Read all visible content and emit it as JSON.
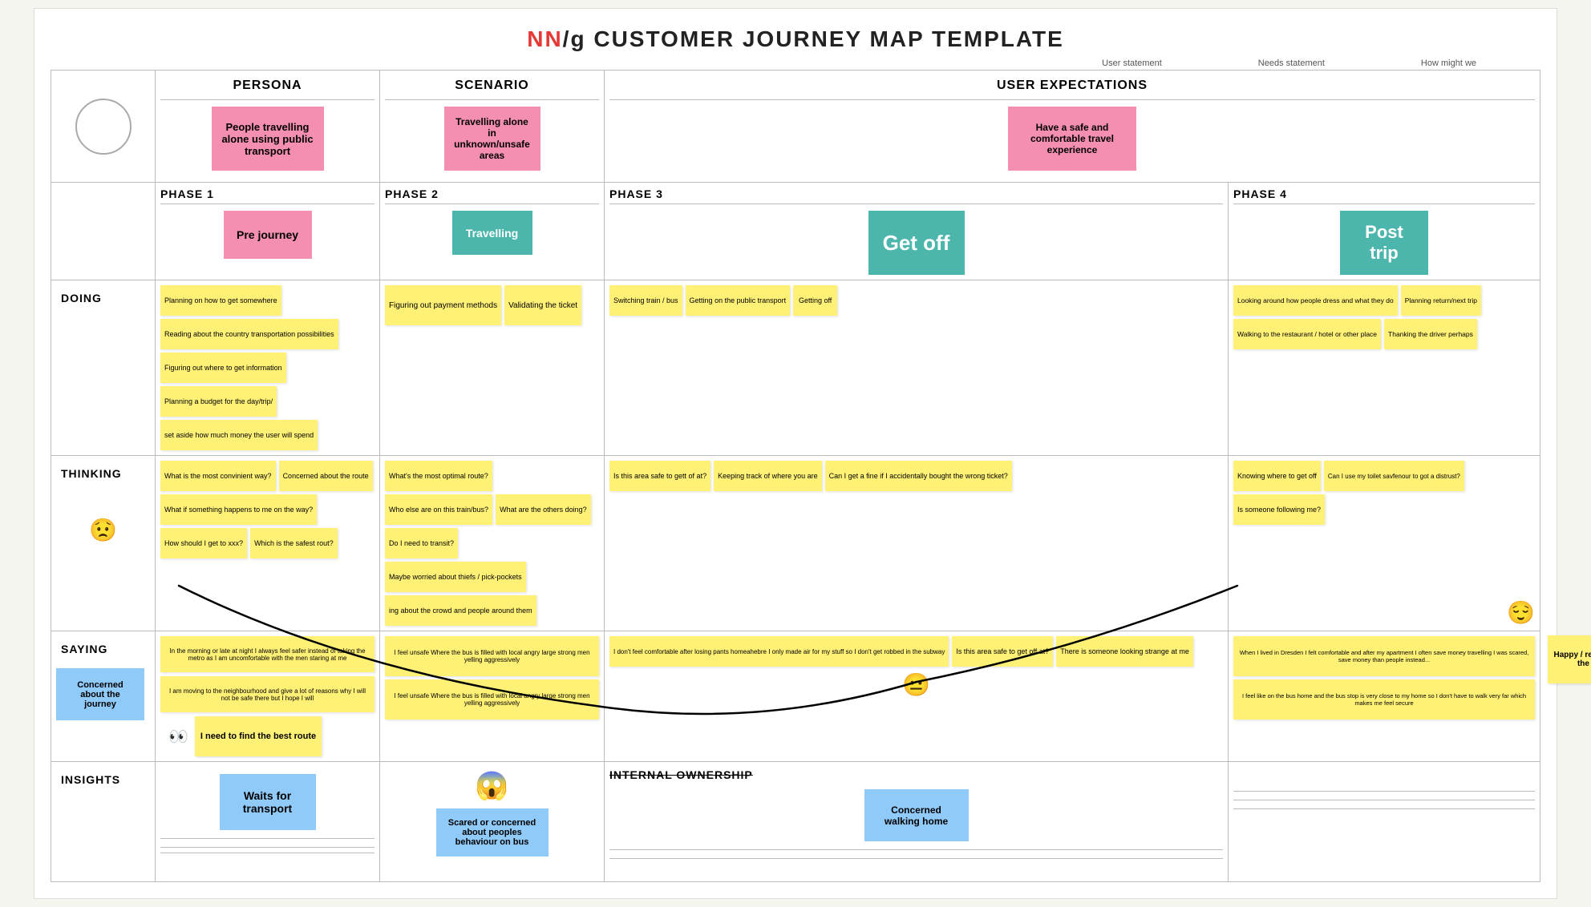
{
  "title": {
    "nn": "NN",
    "slash": "/g",
    "rest": " CUSTOMER JOURNEY MAP TEMPLATE"
  },
  "subheader": {
    "col1": "User statement",
    "col2": "Needs statement",
    "col3": "How might we"
  },
  "persona": {
    "label": "PERSONA",
    "sticky": "People travelling alone using public transport"
  },
  "scenario": {
    "label": "SCENARIO",
    "sticky": "Travelling alone in unknown/unsafe areas"
  },
  "user_expectations": {
    "label": "USER EXPECTATIONS",
    "sticky": "Have a safe and comfortable travel experience"
  },
  "phases": [
    {
      "label": "PHASE 1",
      "sticky": "Pre journey",
      "color": "pink"
    },
    {
      "label": "PHASE 2",
      "sticky": "Travelling",
      "color": "teal"
    },
    {
      "label": "PHASE 3",
      "sticky": "Get off",
      "color": "teal"
    },
    {
      "label": "PHASE 4",
      "sticky": "Post trip",
      "color": "teal"
    }
  ],
  "doing": {
    "label": "DOING",
    "phase1_notes": [
      "Planning on how to get somewhere",
      "Reading about the country transportation possibilities",
      "Figuring out where to get information",
      "Planning a budget for the day/trip/",
      "set aside how much money the user will spend"
    ],
    "phase2_notes": [
      "Figuring out payment methods",
      "Validating the ticket"
    ],
    "phase3_notes": [
      "Switching train / bus",
      "Getting on the public transport",
      "Getting off"
    ],
    "phase4_notes": [
      "Looking around how people dress and what they do",
      "Planning return/next trip",
      "Walking to the restaurant / hotel or other place",
      "Thanking the driver perhaps"
    ]
  },
  "thinking": {
    "label": "THINKING",
    "phase1_notes": [
      "What is the most convinient way?",
      "Concerned about the route",
      "What if something happens to me on the way?",
      "How should I get to xxx?",
      "Which is the safest rout?"
    ],
    "phase2_notes": [
      "What's the most optimal route?",
      "Who else are on this train/bus?",
      "What are the others doing?",
      "Do I need to transit?",
      "Maybe worried about thiefs / pick-pockets",
      "ing about the crowd and people around them"
    ],
    "phase3_notes": [
      "Is this area safe to gett of at?",
      "Keeping track of where you are",
      "Can I get a fine if I accidentally bought the wrong ticket?"
    ],
    "phase4_notes": [
      "Knowing where to get off",
      "Can I use my toilet savfenour to got a distrust?",
      "Is someone following me?"
    ]
  },
  "saying": {
    "label": "SAYING",
    "phase1_notes": [
      "In the morning or late at night I always feel safer instead of taking the metro as I am uncomfortable with the men staring at me",
      "I am moving to the neighbourhood and give a lot of reasons why I will not be safe there but I hope I will"
    ],
    "phase1_main": "I need to find the best route",
    "phase2_notes": [
      "I feel unsafe Where the bus is filled with local angry large strong men yelling aggressively",
      "I feel unsafe Where the bus is filled with local angry large strong men yelling aggressively"
    ],
    "phase3_notes": [
      "I don't feel comfortable after losing pants homeahebre I only made air for my stuff so I don't get robbed in the subway",
      "Is this area safe to get off at?",
      "There is someone looking strange at me"
    ],
    "phase4_notes": [
      "When I lived in Dresden I felt comfortable and after my apartment I often save money travelling I was scared, save money than people instead, save money from people and travelling and save money form"
    ],
    "phase4_main": "I feel like on the bus home and the bus stop is very close to my home so I don't have to walk very far which makes me feel secure",
    "emoji_left": "😟",
    "emoji_right": "😌",
    "concerned_label": "Concerned about the journey",
    "happy_label": "Happy / relieved to reached the destination"
  },
  "insights": {
    "label": "INSIGHTS",
    "phase1_sticky": "Waits for transport",
    "phase2_emoji": "😱",
    "phase2_sticky": "Scared or concerned about peoples behaviour on bus",
    "phase3_label": "INTERNAL OWNERSHIP",
    "phase3_sticky": "Concerned walking home"
  },
  "emojis": {
    "worried": "😟",
    "relieved": "😌",
    "shocked": "😱",
    "neutral": "😐",
    "eyes": "👀"
  }
}
